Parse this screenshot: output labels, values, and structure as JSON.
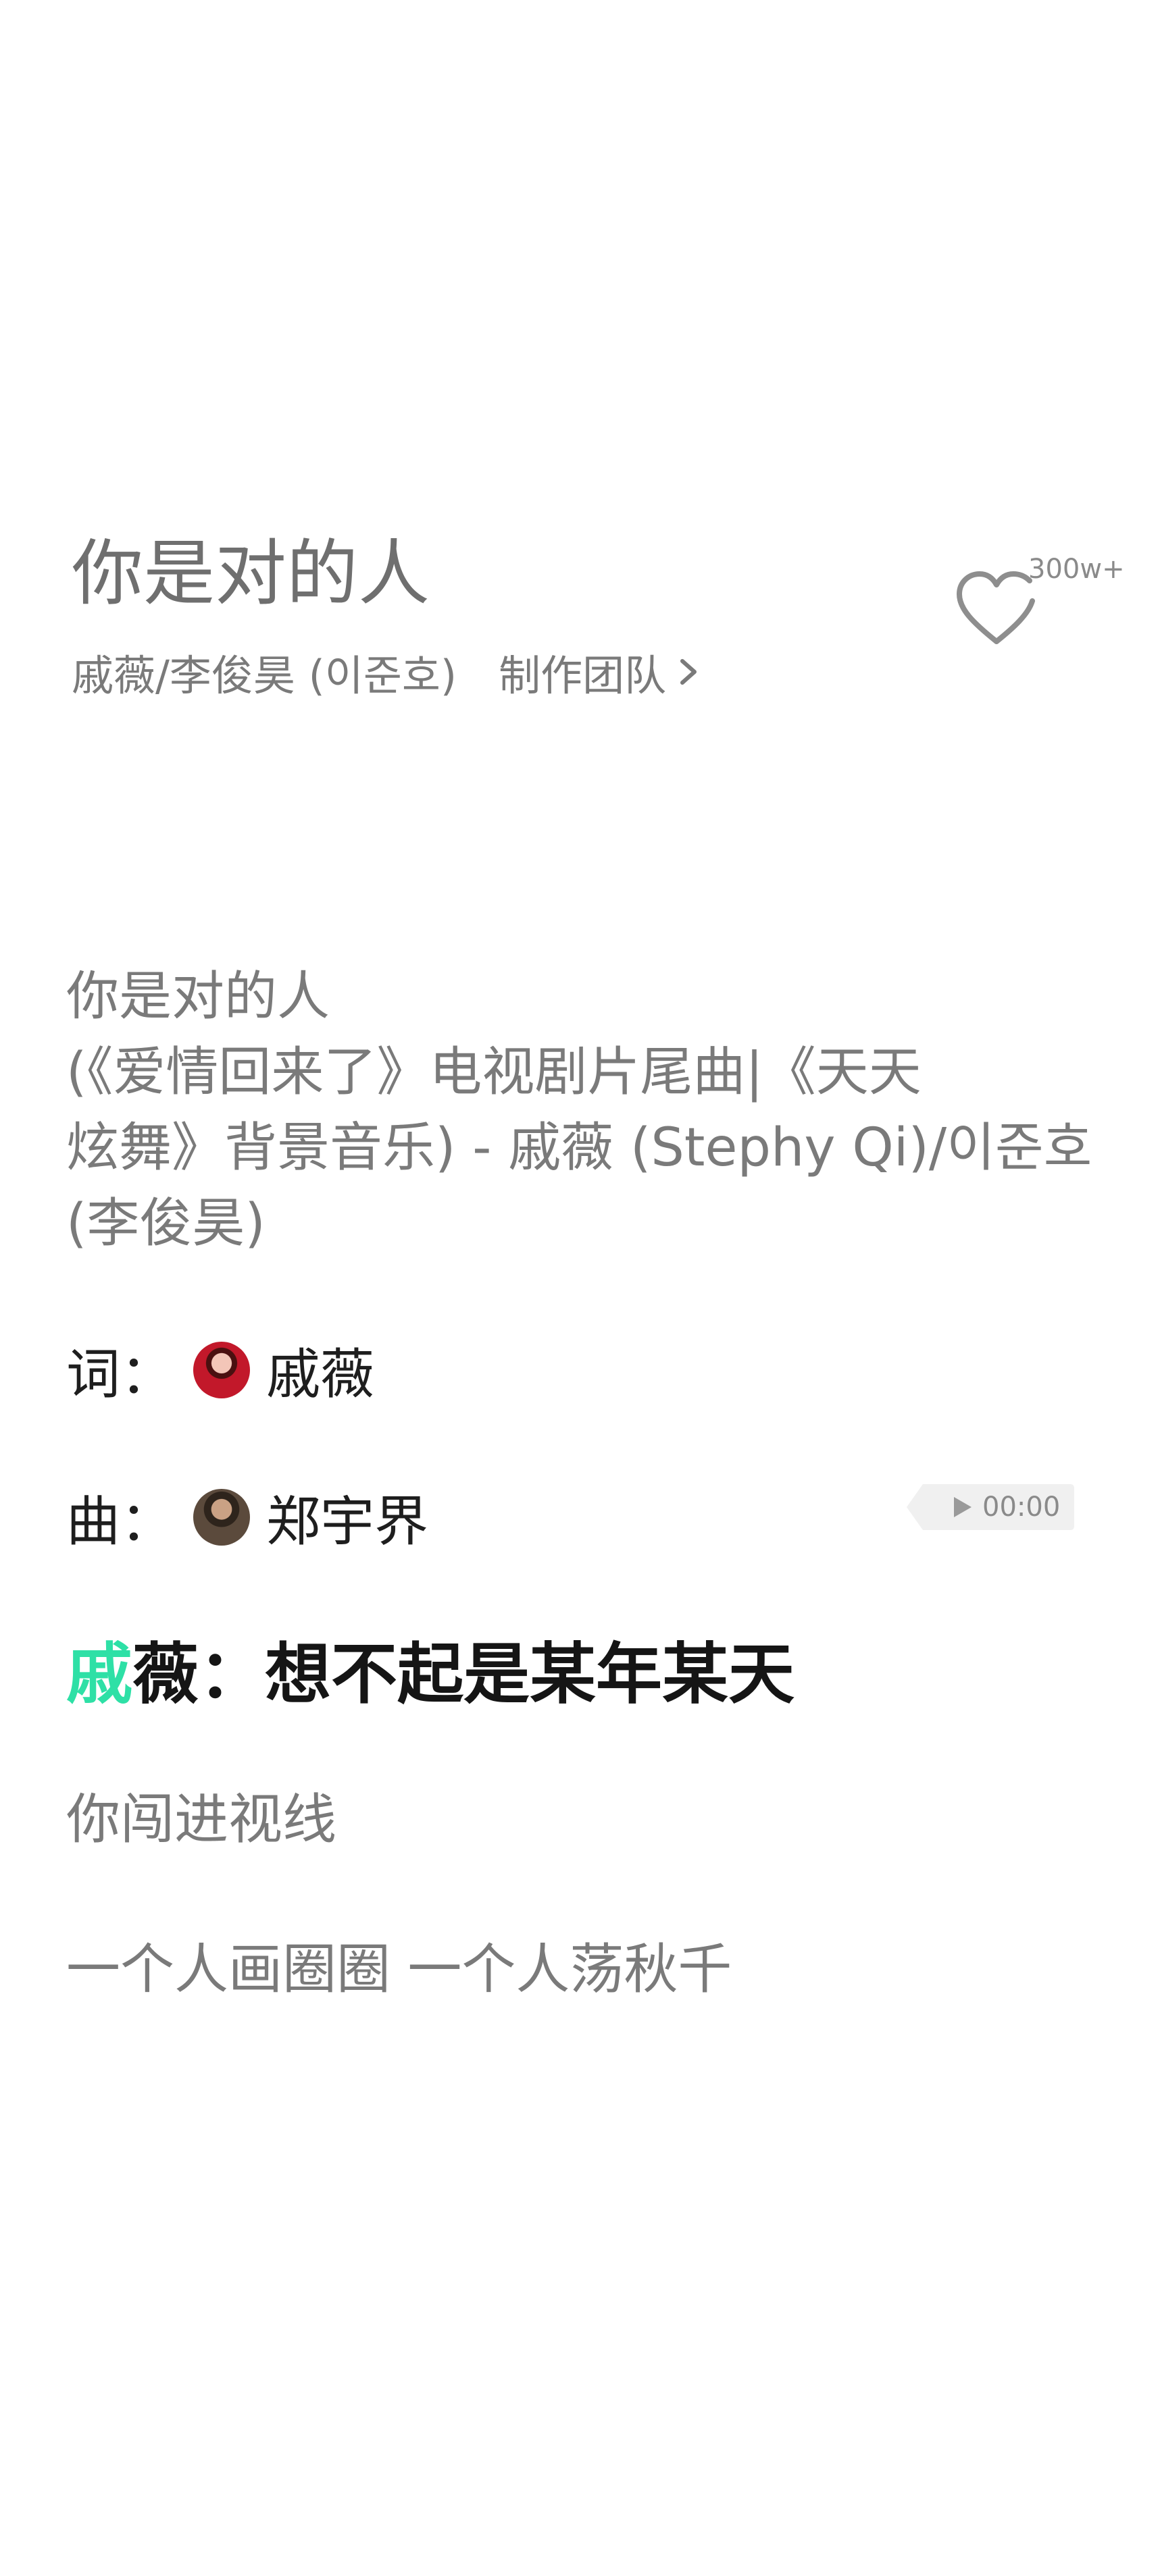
{
  "song": {
    "title": "你是对的人",
    "artists": "戚薇/李俊昊 (이준호)",
    "team_link": "制作团队",
    "like_count": "300w+"
  },
  "lyrics": {
    "intro": [
      "你是对的人",
      "(《爱情回来了》电视剧片尾曲|《天天",
      "炫舞》背景音乐) - 戚薇 (Stephy Qi)/이준호",
      "(李俊昊)"
    ],
    "credits": [
      {
        "label": "词：",
        "name": "戚薇"
      },
      {
        "label": "曲：",
        "name": "郑宇界"
      }
    ],
    "play_time": "00:00",
    "current": {
      "sung": "戚",
      "rest": "薇：想不起是某年某天"
    },
    "lines": [
      "你闯进视线",
      "一个人画圈圈 一个人荡秋千"
    ]
  },
  "colors": {
    "highlight": "#2ee0a6",
    "muted_text": "#7a7a7a",
    "strong_text": "#151515"
  },
  "icons": {
    "like": "heart-outline-icon",
    "team": "chevron-right-icon",
    "play": "play-icon"
  }
}
